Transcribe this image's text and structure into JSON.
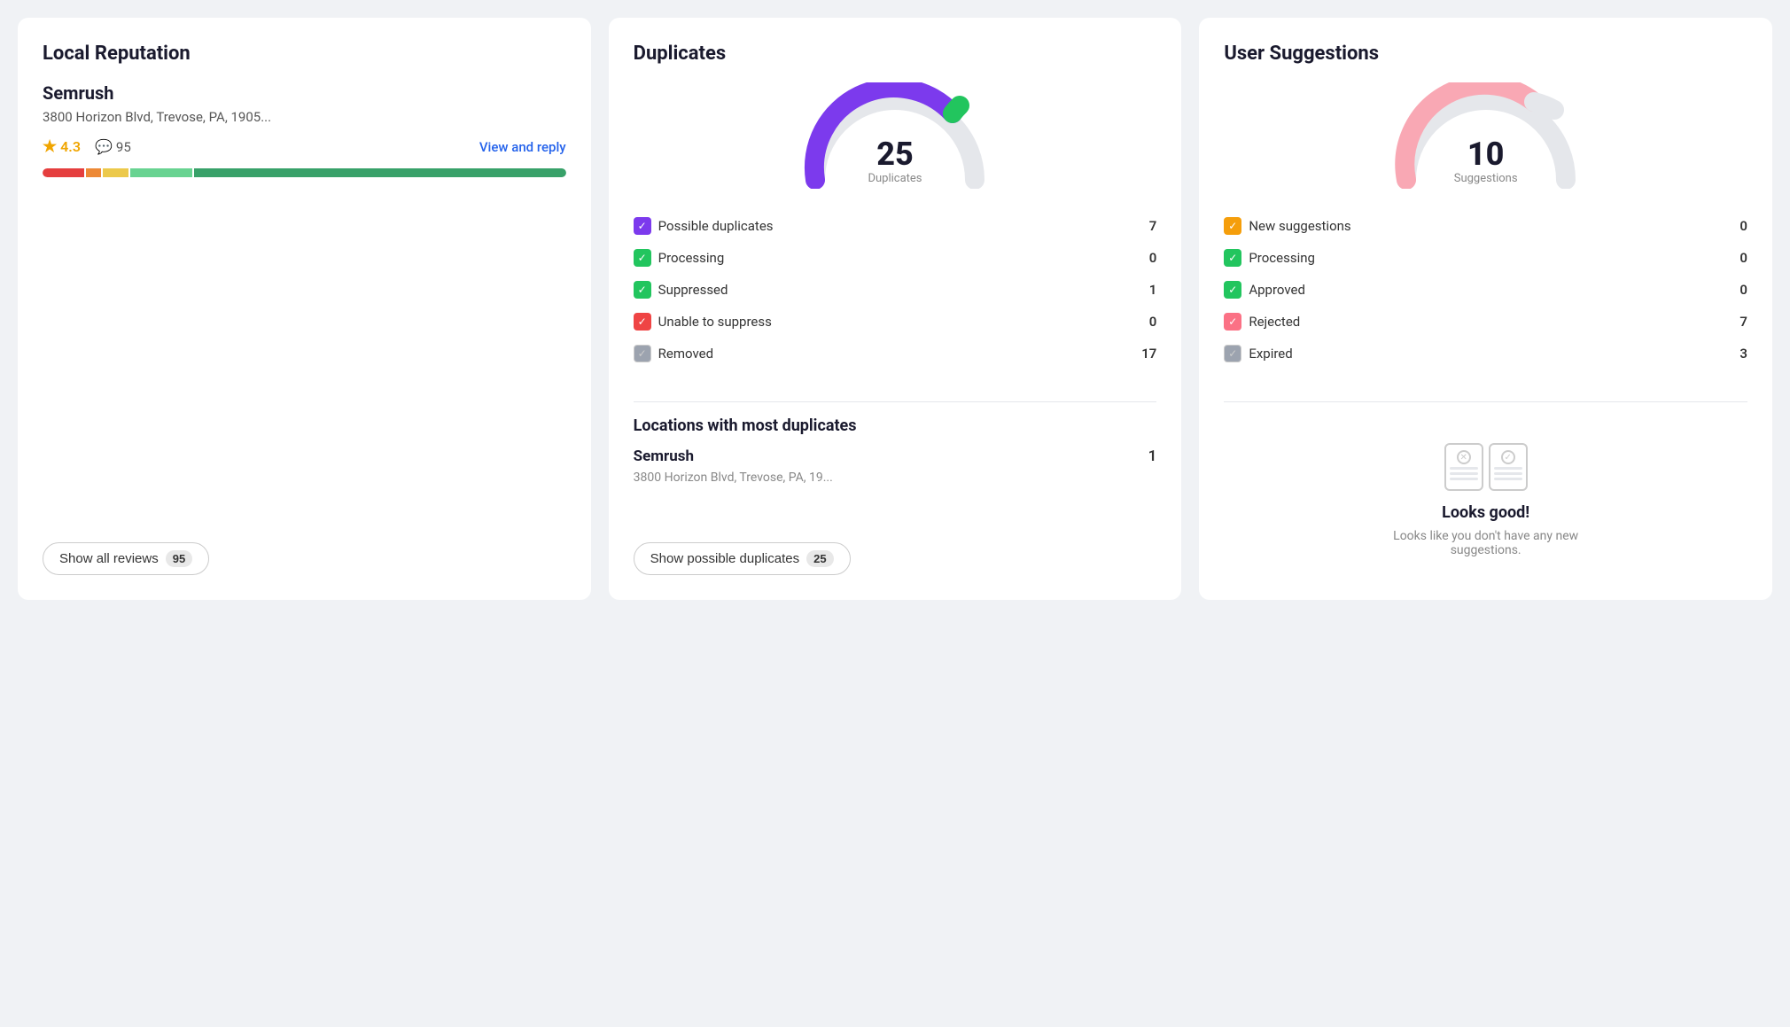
{
  "local_reputation": {
    "title": "Local Reputation",
    "business_name": "Semrush",
    "business_address": "3800 Horizon Blvd, Trevose, PA, 1905...",
    "rating": "4.3",
    "review_count": "95",
    "view_reply_label": "View and reply",
    "show_all_label": "Show all reviews",
    "show_all_count": "95",
    "bar_segments": [
      {
        "color": "red",
        "width": 8
      },
      {
        "color": "orange",
        "width": 3
      },
      {
        "color": "yellow",
        "width": 5
      },
      {
        "color": "light-green",
        "width": 12
      },
      {
        "color": "green",
        "width": 72
      }
    ]
  },
  "duplicates": {
    "title": "Duplicates",
    "gauge_number": "25",
    "gauge_label": "Duplicates",
    "stats": [
      {
        "label": "Possible duplicates",
        "value": "7",
        "icon_type": "purple"
      },
      {
        "label": "Processing",
        "value": "0",
        "icon_type": "green"
      },
      {
        "label": "Suppressed",
        "value": "1",
        "icon_type": "green"
      },
      {
        "label": "Unable to suppress",
        "value": "0",
        "icon_type": "red"
      },
      {
        "label": "Removed",
        "value": "17",
        "icon_type": "gray"
      }
    ],
    "locations_title": "Locations with most duplicates",
    "location_name": "Semrush",
    "location_count": "1",
    "location_address": "3800 Horizon Blvd, Trevose, PA, 19...",
    "show_duplicates_label": "Show possible duplicates",
    "show_duplicates_count": "25"
  },
  "user_suggestions": {
    "title": "User Suggestions",
    "gauge_number": "10",
    "gauge_label": "Suggestions",
    "stats": [
      {
        "label": "New suggestions",
        "value": "0",
        "icon_type": "yellow"
      },
      {
        "label": "Processing",
        "value": "0",
        "icon_type": "green"
      },
      {
        "label": "Approved",
        "value": "0",
        "icon_type": "green"
      },
      {
        "label": "Rejected",
        "value": "7",
        "icon_type": "pink"
      },
      {
        "label": "Expired",
        "value": "3",
        "icon_type": "gray"
      }
    ],
    "empty_title": "Looks good!",
    "empty_text": "Looks like you don't have any new suggestions."
  },
  "icons": {
    "star": "★",
    "chat": "💬",
    "checkmark": "✓",
    "cross": "✕"
  }
}
